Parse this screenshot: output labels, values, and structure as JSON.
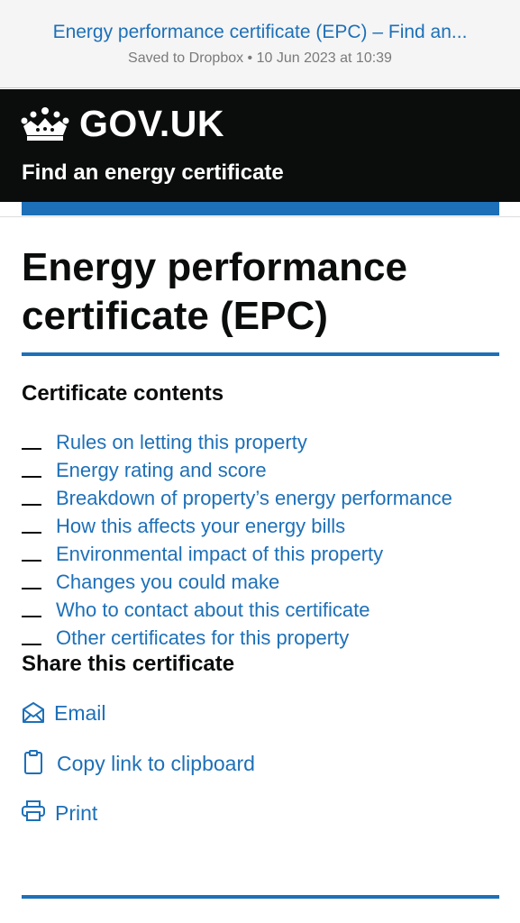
{
  "browser": {
    "title": "Energy performance certificate (EPC) – Find an...",
    "subtitle": "Saved to Dropbox • 10 Jun 2023 at 10:39"
  },
  "header": {
    "logo_text": "GOV.UK",
    "logo_icon": "crown-icon",
    "service_name": "Find an energy certificate"
  },
  "page": {
    "title": "Energy performance certificate (EPC)"
  },
  "contents": {
    "heading": "Certificate contents",
    "items": [
      "Rules on letting this property",
      "Energy rating and score",
      "Breakdown of property’s energy performance",
      "How this affects your energy bills",
      "Environmental impact of this property",
      "Changes you could make",
      "Who to contact about this certificate",
      "Other certificates for this property"
    ]
  },
  "share": {
    "heading": "Share this certificate",
    "email_label": "Email",
    "email_icon": "envelope-icon",
    "copy_label": "Copy link to clipboard",
    "copy_icon": "clipboard-icon",
    "print_label": "Print",
    "print_icon": "printer-icon"
  },
  "colors": {
    "link": "#1d70b8",
    "header_bg": "#0b0c0c",
    "accent_bar": "#1d70b8",
    "text": "#0b0c0c"
  }
}
